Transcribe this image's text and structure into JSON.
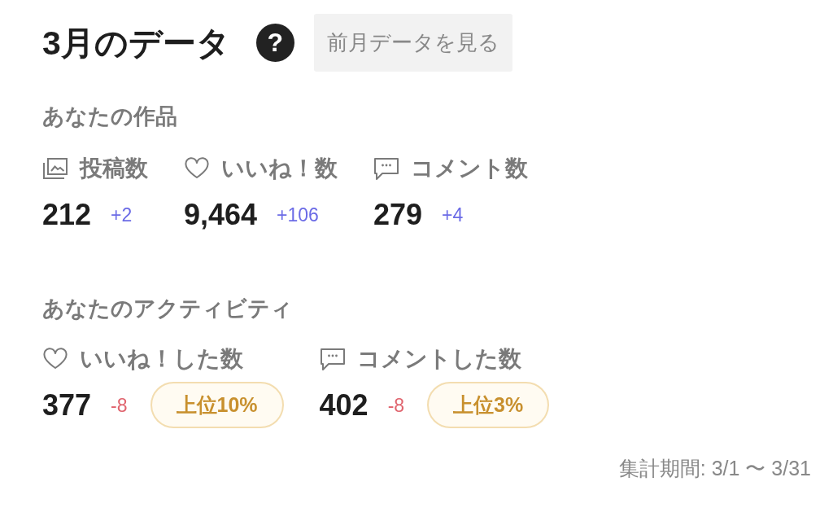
{
  "header": {
    "title": "3月のデータ",
    "help_button": {
      "label": "?"
    },
    "previous_month_button": {
      "label": "前月データを見る"
    }
  },
  "works": {
    "heading": "あなたの作品",
    "stats": [
      {
        "kind": "posts",
        "label": "投稿数",
        "value": "212",
        "change": "+2",
        "increase": true
      },
      {
        "kind": "likes",
        "label": "いいね！数",
        "value": "9,464",
        "change": "+106",
        "increase": true
      },
      {
        "kind": "comments",
        "label": "コメント数",
        "value": "279",
        "change": "+4",
        "increase": true
      }
    ]
  },
  "activity": {
    "heading": "あなたのアクティビティ",
    "stats": [
      {
        "kind": "likes",
        "label": "いいね！した数",
        "value": "377",
        "change": "-8",
        "increase": false,
        "rank": "上位10%"
      },
      {
        "kind": "comments",
        "label": "コメントした数",
        "value": "402",
        "change": "-8",
        "increase": false,
        "rank": "上位3%"
      }
    ]
  },
  "footer": {
    "period": "集計期間: 3/1 〜 3/31"
  }
}
